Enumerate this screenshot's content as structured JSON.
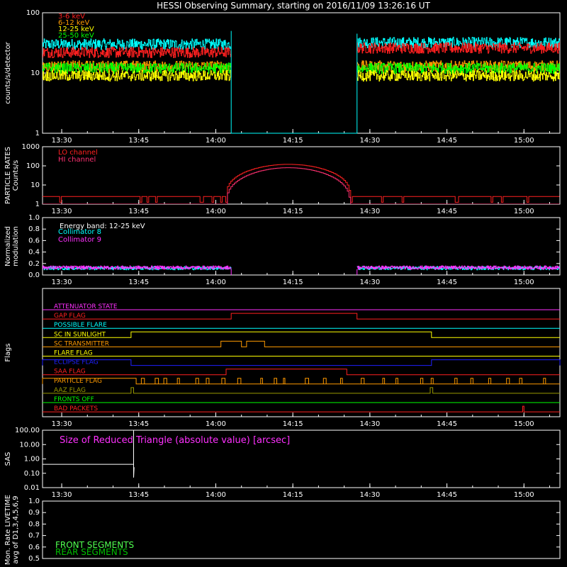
{
  "title": "HESSI Observing Summary, starting on 2016/11/09 13:26:16 UT",
  "colors": {
    "background": "#000000",
    "axis": "#ffffff",
    "red": "#ff2020",
    "orange": "#ff9a00",
    "yellow": "#ffff00",
    "green": "#00ff00",
    "cyan": "#00ffff",
    "magenta": "#ff30ff",
    "pink": "#ff3070",
    "blue": "#2020ff",
    "olive": "#9a9a00",
    "darkgreen": "#00c000",
    "lightgreen": "#50ff50",
    "gray": "#9a9a9a"
  },
  "chart_data": [
    {
      "id": "count-rates",
      "type": "line",
      "ylabel": "counts/s/detector",
      "yscale": "log",
      "ylim": [
        1,
        100
      ],
      "ytick_labels": [
        "1",
        "10",
        "100"
      ],
      "xlim": [
        "13:26:16",
        "15:07:00"
      ],
      "xtick_labels": [
        "13:30",
        "13:45",
        "14:00",
        "14:15",
        "14:30",
        "14:45",
        "15:00"
      ],
      "data_gap": [
        "14:03:00",
        "14:27:30"
      ],
      "series": [
        {
          "name": "3-6 keV",
          "color": "red",
          "level_before_gap": 22,
          "level_after_gap": 26
        },
        {
          "name": "6-12 keV",
          "color": "orange",
          "level_before_gap": 13,
          "level_after_gap": 13
        },
        {
          "name": "12-25 keV",
          "color": "yellow",
          "level_before_gap": 9,
          "level_after_gap": 9
        },
        {
          "name": "25-50 keV",
          "color": "green",
          "level_before_gap": 12,
          "level_after_gap": 12
        },
        {
          "color": "cyan",
          "level_before_gap": 30,
          "level_after_gap": 32
        }
      ]
    },
    {
      "id": "particle-rates",
      "type": "line",
      "ylabel": "PARTICLE RATES\nCounts/s",
      "yscale": "log",
      "ylim": [
        1,
        1000
      ],
      "ytick_labels": [
        "1",
        "10",
        "100",
        "1000"
      ],
      "xlim": [
        "13:26:16",
        "15:07:00"
      ],
      "xtick_labels": [
        "13:30",
        "13:45",
        "14:00",
        "14:15",
        "14:30",
        "14:45",
        "15:00"
      ],
      "series": [
        {
          "name": "LO channel",
          "color": "red",
          "baseline": 2.5,
          "peak": 120
        },
        {
          "name": "HI channel",
          "color": "pink",
          "baseline": 1.0,
          "peak": 80
        }
      ],
      "peak_interval": [
        "14:02:00",
        "14:26:00"
      ]
    },
    {
      "id": "modulation",
      "type": "line",
      "ylabel": "Normalized\nmodulation",
      "ylim": [
        0,
        1
      ],
      "ytick_labels": [
        "0.0",
        "0.2",
        "0.4",
        "0.6",
        "0.8",
        "1.0"
      ],
      "xlim": [
        "13:26:16",
        "15:07:00"
      ],
      "xtick_labels": [
        "13:30",
        "13:45",
        "14:00",
        "14:15",
        "14:30",
        "14:45",
        "15:00"
      ],
      "annotation": "Energy band: 12-25 keV",
      "data_gap": [
        "14:03:00",
        "14:27:30"
      ],
      "series": [
        {
          "name": "Collimator 8",
          "color": "cyan",
          "level": 0.12
        },
        {
          "name": "Collimator 9",
          "color": "magenta",
          "level": 0.13
        }
      ]
    },
    {
      "id": "flags",
      "type": "line",
      "ylabel": "Flags",
      "xlim": [
        "13:26:16",
        "15:07:00"
      ],
      "xtick_labels": [
        "13:30",
        "13:45",
        "14:00",
        "14:15",
        "14:30",
        "14:45",
        "15:00"
      ],
      "flags": [
        {
          "name": "ATTENUATOR STATE",
          "color": "magenta",
          "high": []
        },
        {
          "name": "GAP FLAG",
          "color": "red",
          "high": [
            [
              "14:03:00",
              "14:27:30"
            ]
          ]
        },
        {
          "name": "POSSIBLE FLARE",
          "color": "cyan",
          "high": []
        },
        {
          "name": "SC IN SUNLIGHT",
          "color": "yellow",
          "high": [
            [
              "13:43:30",
              "14:42:00"
            ]
          ]
        },
        {
          "name": "SC TRANSMITTER",
          "color": "orange",
          "high": [
            [
              "14:01:00",
              "14:05:00"
            ],
            [
              "14:06:00",
              "14:09:30"
            ]
          ]
        },
        {
          "name": "FLARE FLAG",
          "color": "yellow",
          "high": []
        },
        {
          "name": "ECLIPSE FLAG",
          "color": "blue",
          "high": [
            [
              "13:26:16",
              "13:43:30"
            ],
            [
              "14:42:00",
              "15:07:00"
            ]
          ]
        },
        {
          "name": "SAA FLAG",
          "color": "red",
          "high": [
            [
              "14:02:00",
              "14:25:30"
            ]
          ]
        },
        {
          "name": "PARTICLE FLAG",
          "color": "orange",
          "high": [
            [
              "13:26:16",
              "13:44:30"
            ]
          ],
          "spiky": true
        },
        {
          "name": "AAZ FLAG",
          "color": "olive",
          "high": [
            [
              "13:43:30",
              "13:44:00"
            ],
            [
              "14:41:45",
              "14:42:15"
            ]
          ]
        },
        {
          "name": "FRONTS OFF",
          "color": "green",
          "high": []
        },
        {
          "name": "BAD PACKETS",
          "color": "red",
          "high": [
            [
              "14:59:45",
              "15:00:00"
            ]
          ]
        }
      ]
    },
    {
      "id": "sas",
      "type": "line",
      "ylabel": "SAS",
      "yscale": "log",
      "ylim": [
        0.01,
        100
      ],
      "ytick_labels": [
        "0.01",
        "0.10",
        "1.00",
        "10.00",
        "100.00"
      ],
      "xlim": [
        "13:26:16",
        "15:07:00"
      ],
      "xtick_labels": [
        "13:30",
        "13:45",
        "14:00",
        "14:15",
        "14:30",
        "14:45",
        "15:00"
      ],
      "annotation": "Size of Reduced Triangle (absolute value) [arcsec]",
      "series": [
        {
          "color": "white",
          "level_before": 0.42,
          "spike_times": [
            "13:44:00",
            "14:42:00"
          ],
          "level_during": 0.75
        }
      ]
    },
    {
      "id": "livetime",
      "type": "line",
      "ylabel": "Mon. Rate LIVETIME\navg of D1,3,4,5,6,9",
      "ylim": [
        0.5,
        1.0
      ],
      "ytick_labels": [
        "0.5",
        "0.6",
        "0.7",
        "0.8",
        "0.9",
        "1.0"
      ],
      "xlim": [
        "13:26:16",
        "15:07:00"
      ],
      "series": [
        {
          "name": "FRONT SEGMENTS",
          "color": "lightgreen"
        },
        {
          "name": "REAR SEGMENTS",
          "color": "darkgreen"
        }
      ]
    }
  ]
}
